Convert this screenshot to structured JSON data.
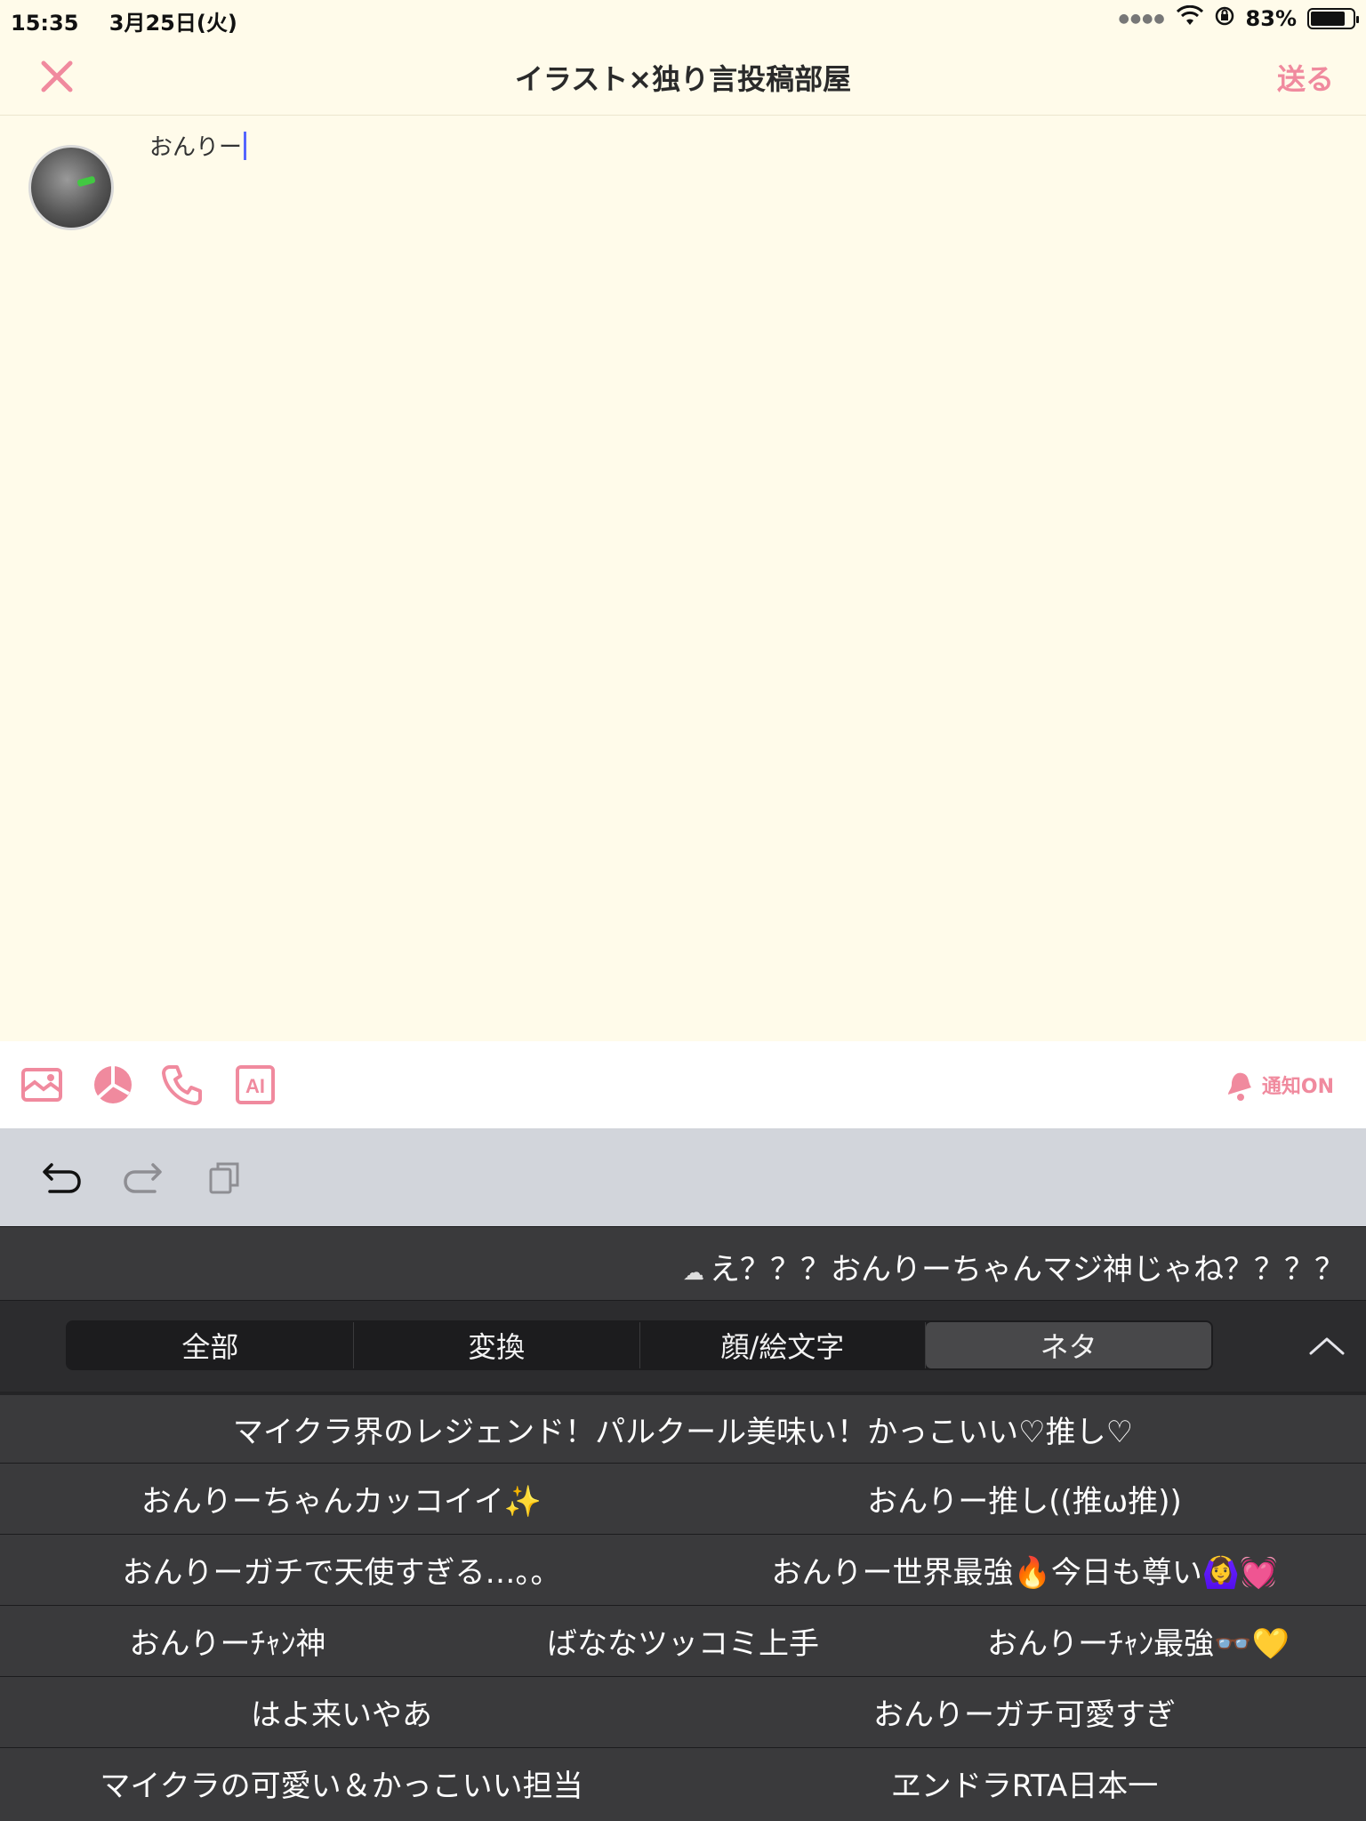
{
  "status_bar": {
    "time": "15:35",
    "date": "3月25日(火)",
    "battery": "83%",
    "battery_level": 0.83
  },
  "nav": {
    "title": "イラスト×独り言投稿部屋",
    "send_label": "送る"
  },
  "compose": {
    "text": "おんりー"
  },
  "toolbar": {
    "icons": [
      "image-icon",
      "pie-chart-icon",
      "phone-icon",
      "ai-icon"
    ],
    "ai_label": "AI",
    "notify_label": "通知ON"
  },
  "keyboard": {
    "top_suggestion": "え？？？おんりーちゃんマジ神じゃね？？？？",
    "tabs": [
      "全部",
      "変換",
      "顔/絵文字",
      "ネタ"
    ],
    "active_tab": "ネタ",
    "rows": [
      [
        "マイクラ界のレジェンド！パルクール美味い！かっこいい♡推し♡"
      ],
      [
        "おんりーちゃんカッコイイ✨",
        "おんりー推し((推ω推))"
      ],
      [
        "おんりーガチで天使すぎる…。。",
        "おんりー世界最強🔥今日も尊い🙆‍♀️💓"
      ],
      [
        "おんりーﾁｬﾝ神",
        "ばななツッコミ上手",
        "おんりーﾁｬﾝ最強👓💛"
      ],
      [
        "はよ来いやあ",
        "おんりーガチ可愛すぎ"
      ],
      [
        "マイクラの可愛い＆かっこいい担当",
        "ヱンドラRTA日本一"
      ]
    ]
  },
  "colors": {
    "accent": "#f08a9e",
    "background": "#fffbea",
    "keyboard_dark": "#3a3a3c"
  }
}
